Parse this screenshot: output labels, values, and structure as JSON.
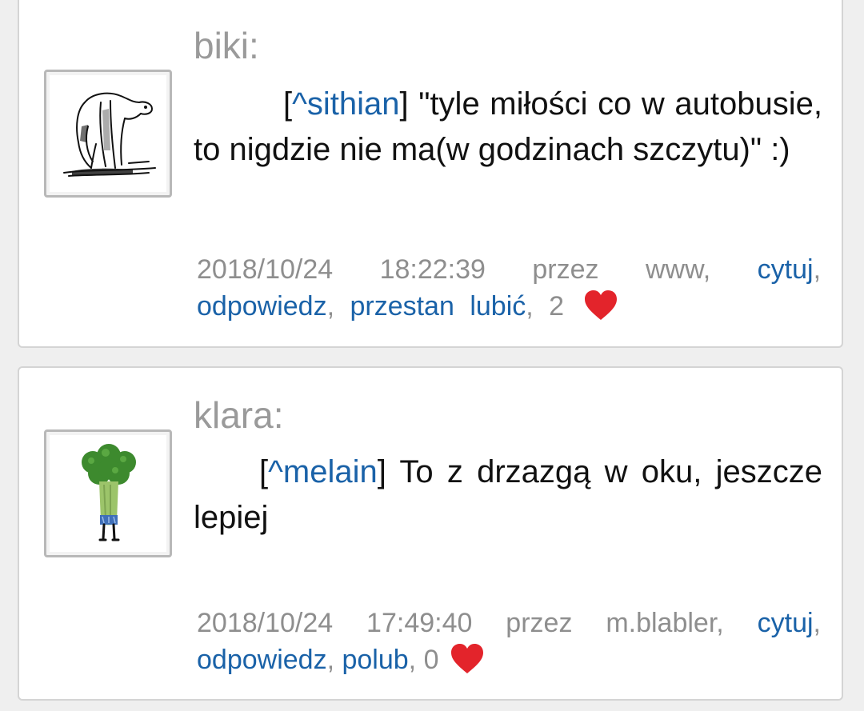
{
  "comments": [
    {
      "author": "biki:",
      "mention": "^sithian",
      "text": " \"tyle miłości co w autobusie, to nigdzie nie ma(w godzinach szczytu)\" :)",
      "meta": {
        "datetime": "2018/10/24 18:22:39",
        "via": "przez www,",
        "quote_label": "cytuj",
        "reply_label": "odpowiedz",
        "like_label": "przestan lubić",
        "likes": "2"
      },
      "avatar_icon": "vulture-sketch-avatar"
    },
    {
      "author": "klara:",
      "mention": "^melain",
      "text": " To z drzazgą w oku, jeszcze lepiej",
      "meta": {
        "datetime": "2018/10/24 17:49:40",
        "via": "przez m.blabler,",
        "quote_label": "cytuj",
        "reply_label": "odpowiedz",
        "like_label": "polub",
        "likes": "0"
      },
      "avatar_icon": "broccoli-character-avatar"
    }
  ],
  "colors": {
    "link": "#1a62a8",
    "author": "#9a9a9a",
    "meta": "#8e8e8e",
    "heart": "#e3242b"
  }
}
